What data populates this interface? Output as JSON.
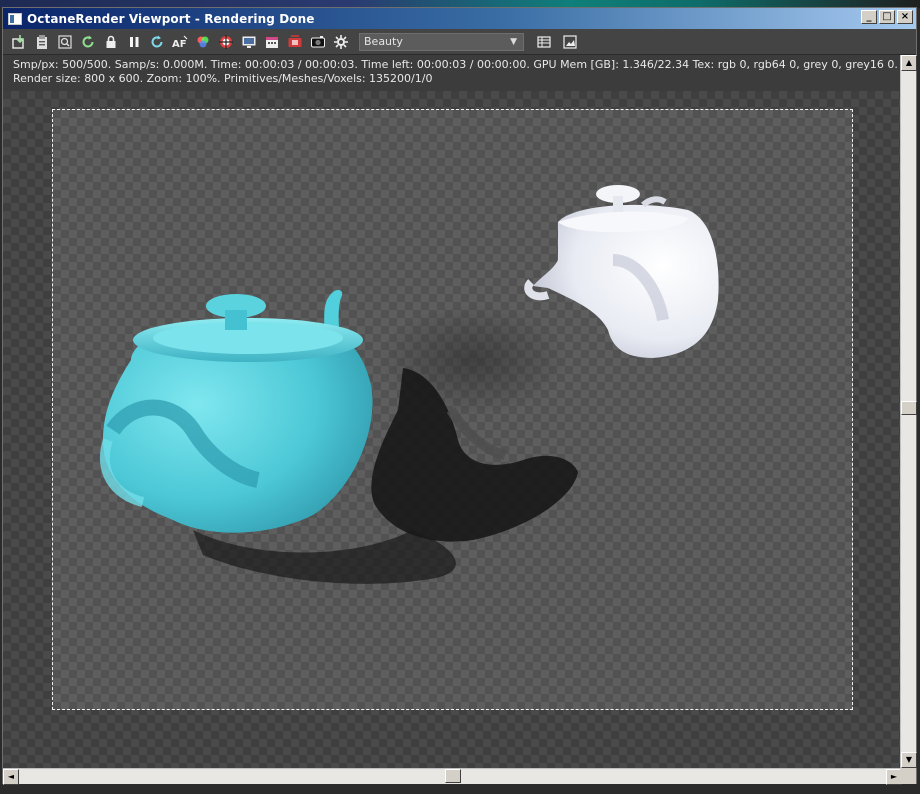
{
  "window": {
    "title": "OctaneRender Viewport - Rendering Done",
    "buttons": {
      "minimize": "_",
      "maximize": "□",
      "close": "×"
    }
  },
  "toolbar": {
    "icons": [
      "import-icon",
      "clipboard-icon",
      "zoom-region-icon",
      "restart-render-icon",
      "lock-icon",
      "pause-icon",
      "refresh-icon",
      "af-icon",
      "color-wheel-icon",
      "target-icon",
      "display-icon",
      "calendar-icon",
      "film-icon",
      "camera-icon",
      "settings-gear-icon"
    ],
    "pass_select": {
      "value": "Beauty",
      "caret": "▼"
    },
    "right_icons": [
      "list-icon",
      "image-save-icon"
    ]
  },
  "status": {
    "line1": "Smp/px: 500/500.   Samp/s: 0.000M.   Time: 00:00:03 / 00:00:03.   Time left: 00:00:03 / 00:00:00.   GPU Mem [GB]: 1.346/22.34   Tex: rgb 0, rgb64 0, grey 0, grey16 0.",
    "line2": "Render size: 800 x 600.   Zoom: 100%.   Primitives/Meshes/Voxels: 135200/1/0"
  },
  "scrollbars": {
    "up": "▲",
    "down": "▼",
    "left": "◄",
    "right": "►"
  },
  "colors": {
    "teapot_cyan": "#4fd0dc",
    "teapot_white": "#eef0f6",
    "titlebar_start": "#0a246a"
  }
}
